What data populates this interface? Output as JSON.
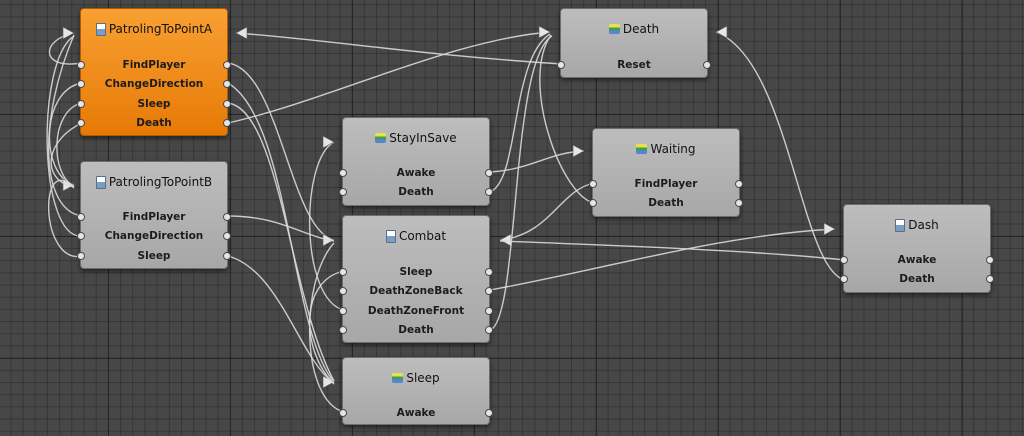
{
  "colors": {
    "active_node": "#f08c1c",
    "node": "#b3b3b3",
    "wire": "#d9d9d9"
  },
  "nodes": {
    "patrolingToPointA": {
      "title": "PatrolingToPointA",
      "icon": "state-machine-icon",
      "active": true,
      "outputs": [
        "FindPlayer",
        "ChangeDirection",
        "Sleep",
        "Death"
      ]
    },
    "patrolingToPointB": {
      "title": "PatrolingToPointB",
      "icon": "state-machine-icon",
      "outputs": [
        "FindPlayer",
        "ChangeDirection",
        "Sleep"
      ]
    },
    "death": {
      "title": "Death",
      "icon": "state-icon",
      "outputs": [
        "Reset"
      ]
    },
    "stayInSave": {
      "title": "StayInSave",
      "icon": "state-icon",
      "outputs": [
        "Awake",
        "Death"
      ]
    },
    "waiting": {
      "title": "Waiting",
      "icon": "state-icon",
      "outputs": [
        "FindPlayer",
        "Death"
      ]
    },
    "combat": {
      "title": "Combat",
      "icon": "state-machine-icon",
      "outputs": [
        "Sleep",
        "DeathZoneBack",
        "DeathZoneFront",
        "Death"
      ]
    },
    "dash": {
      "title": "Dash",
      "icon": "state-machine-icon",
      "outputs": [
        "Awake",
        "Death"
      ]
    },
    "sleep": {
      "title": "Sleep",
      "icon": "state-icon",
      "outputs": [
        "Awake"
      ]
    }
  },
  "transitions": [
    {
      "from": "PatrolingToPointA",
      "output": "FindPlayer",
      "to": "PatrolingToPointB"
    },
    {
      "from": "PatrolingToPointA",
      "output": "ChangeDirection",
      "to": "PatrolingToPointB"
    },
    {
      "from": "PatrolingToPointA",
      "output": "Sleep",
      "to": "Combat"
    },
    {
      "from": "PatrolingToPointA",
      "output": "Death",
      "to": "Death"
    },
    {
      "from": "PatrolingToPointB",
      "output": "FindPlayer",
      "to": "Combat"
    },
    {
      "from": "PatrolingToPointB",
      "output": "ChangeDirection",
      "to": "PatrolingToPointA"
    },
    {
      "from": "PatrolingToPointB",
      "output": "Sleep",
      "to": "Sleep"
    },
    {
      "from": "Death",
      "output": "Reset",
      "to": "PatrolingToPointA"
    },
    {
      "from": "StayInSave",
      "output": "Awake",
      "to": "Waiting"
    },
    {
      "from": "StayInSave",
      "output": "Death",
      "to": "Death"
    },
    {
      "from": "Waiting",
      "output": "FindPlayer",
      "to": "Combat"
    },
    {
      "from": "Waiting",
      "output": "Death",
      "to": "Death"
    },
    {
      "from": "Combat",
      "output": "Sleep",
      "to": "Sleep"
    },
    {
      "from": "Combat",
      "output": "DeathZoneBack",
      "to": "Dash"
    },
    {
      "from": "Combat",
      "output": "DeathZoneFront",
      "to": "StayInSave"
    },
    {
      "from": "Combat",
      "output": "Death",
      "to": "Death"
    },
    {
      "from": "Dash",
      "output": "Awake",
      "to": "Combat"
    },
    {
      "from": "Dash",
      "output": "Death",
      "to": "Death"
    },
    {
      "from": "Sleep",
      "output": "Awake",
      "to": "Combat"
    }
  ]
}
